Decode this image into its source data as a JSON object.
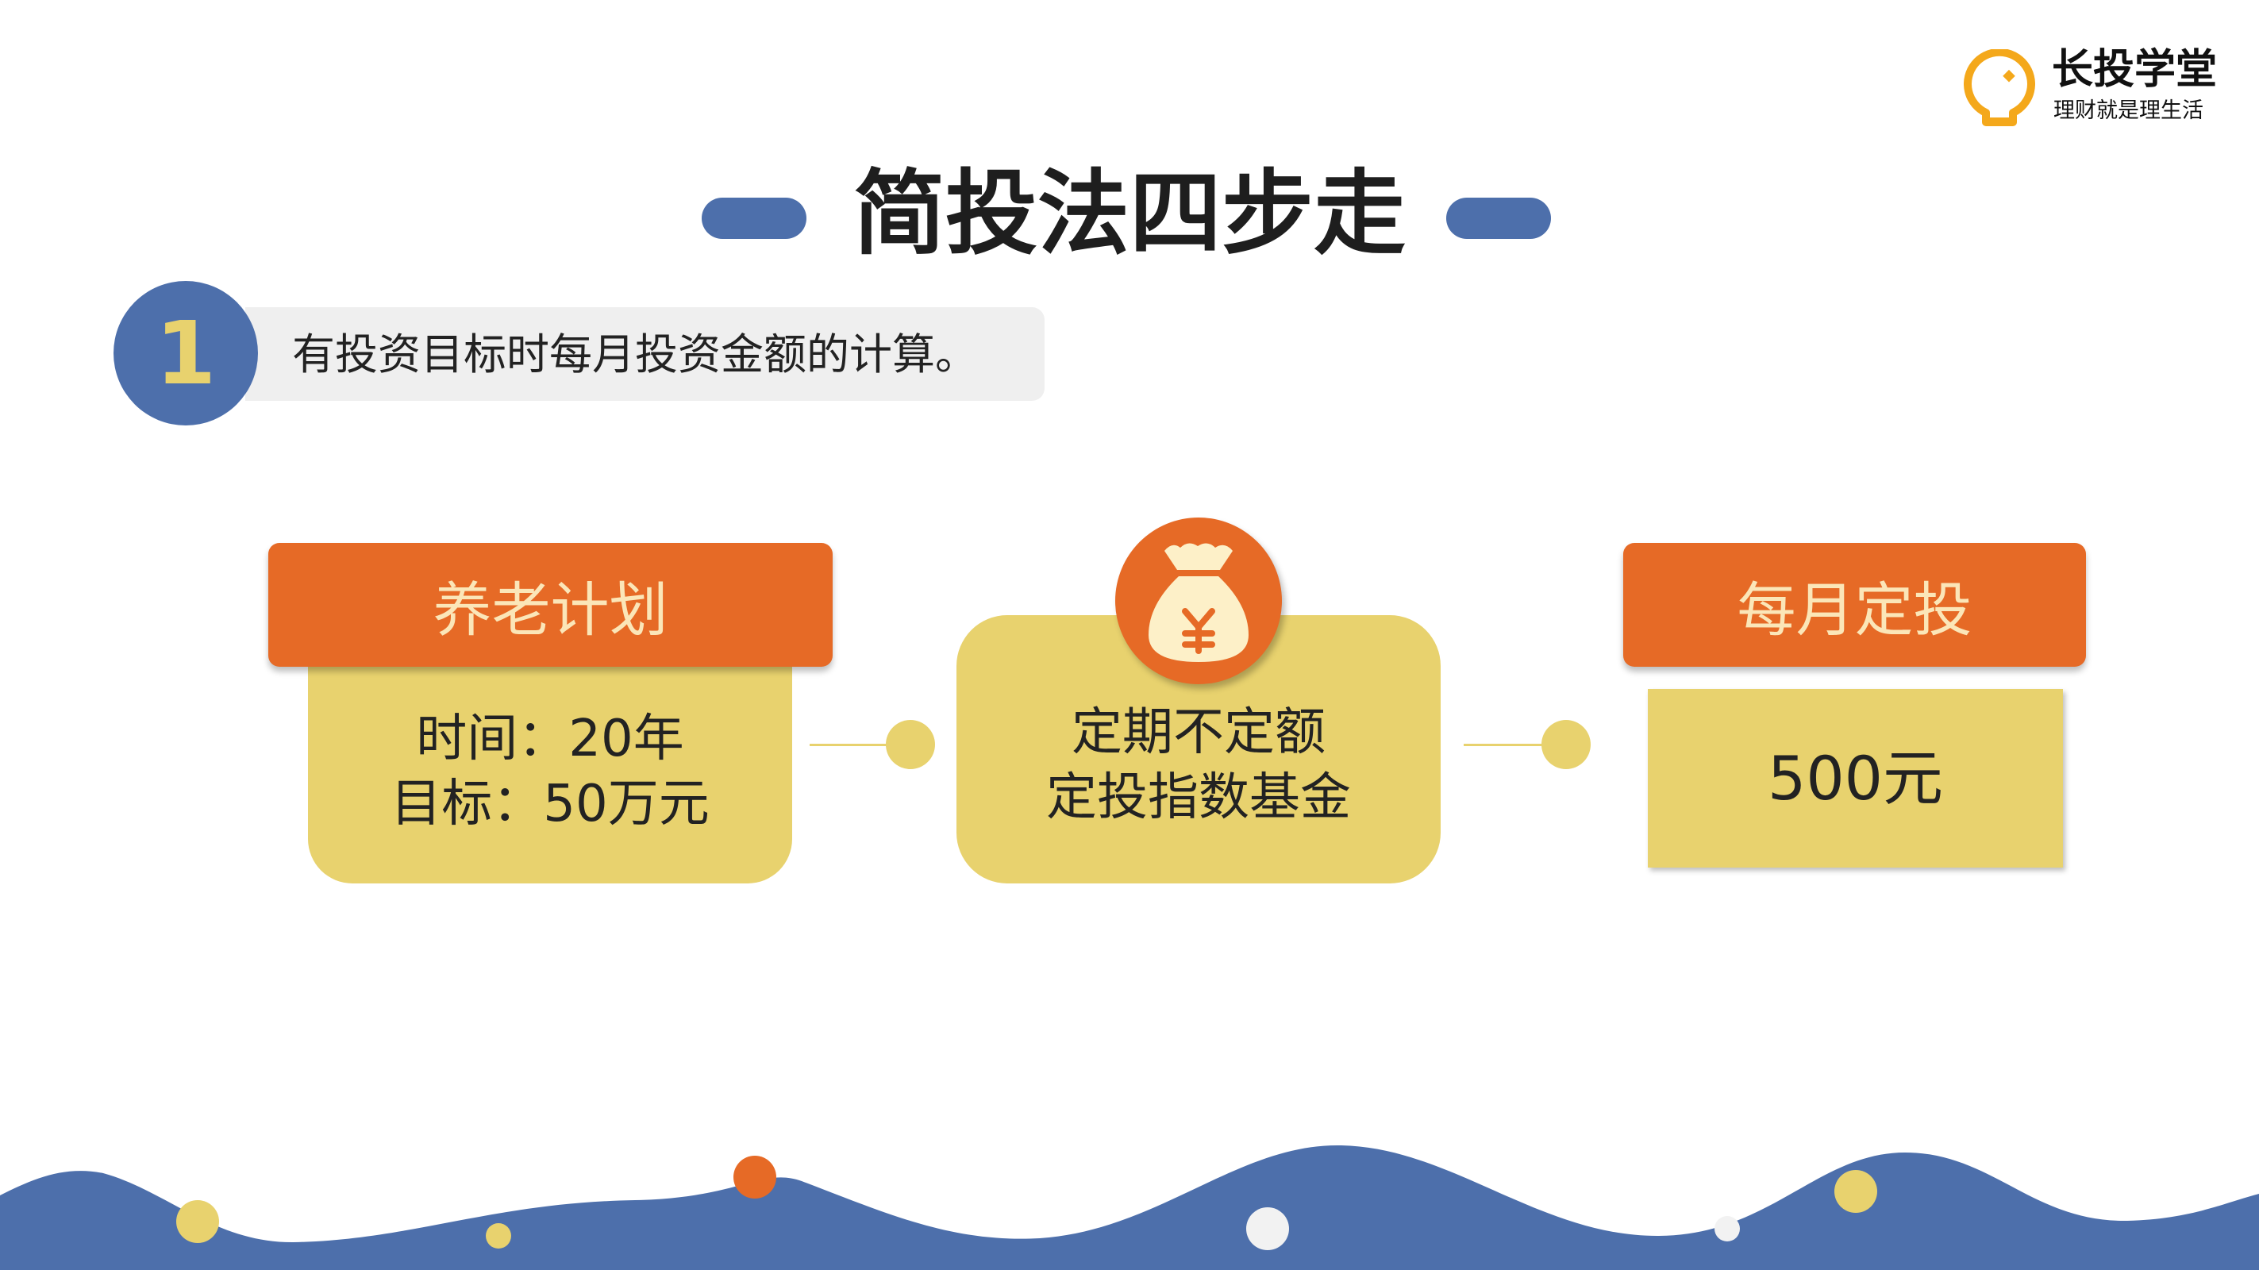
{
  "logo": {
    "name": "长投学堂",
    "slogan": "理财就是理生活"
  },
  "title": "简投法四步走",
  "step": {
    "number": "1",
    "text": "有投资目标时每月投资金额的计算。"
  },
  "left_card": {
    "header": "养老计划",
    "lines": [
      "时间：20年",
      "目标：50万元"
    ]
  },
  "center_card": {
    "icon": "money-bag-yen-icon",
    "lines": [
      "定期不定额",
      "定投指数基金"
    ]
  },
  "right_card": {
    "header": "每月定投",
    "value": "500元"
  },
  "colors": {
    "blue": "#4d6fab",
    "orange": "#e66a26",
    "yellow": "#e8d26e",
    "gray": "#efefef"
  }
}
